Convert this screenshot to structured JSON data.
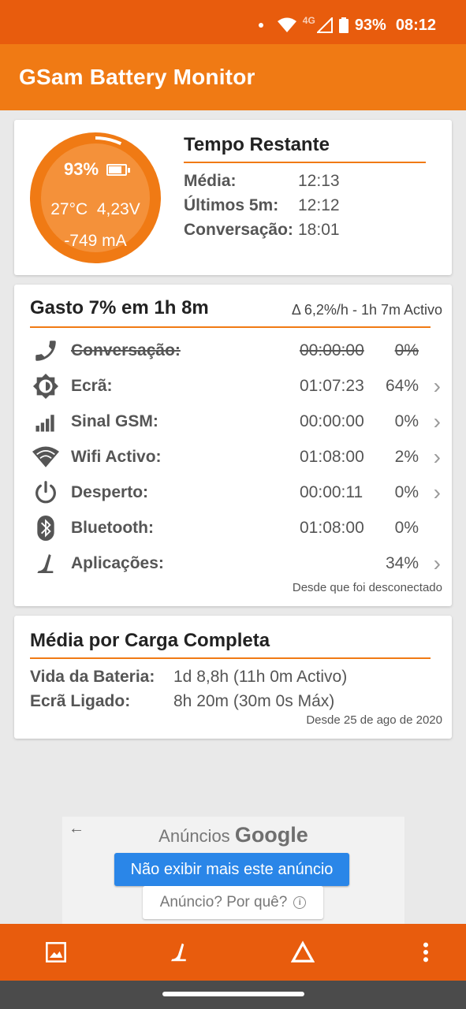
{
  "status_bar": {
    "network": "4G",
    "battery": "93%",
    "time": "08:12"
  },
  "app": {
    "title": "GSam Battery Monitor"
  },
  "colors": {
    "accent": "#f07a14",
    "dark_accent": "#e85c0d",
    "ad_button": "#2a86e8"
  },
  "gauge": {
    "percent_label": "93%",
    "temperature": "27°C",
    "voltage": "4,23V",
    "current": "-749 mA",
    "level": 0.93
  },
  "time_remaining": {
    "title": "Tempo Restante",
    "rows": [
      {
        "label": "Média:",
        "value": "12:13"
      },
      {
        "label": "Últimos 5m:",
        "value": "12:12"
      },
      {
        "label": "Conversação:",
        "value": "18:01"
      }
    ]
  },
  "usage": {
    "title": "Gasto 7% em 1h 8m",
    "rate": "Δ 6,2%/h - 1h 7m Activo",
    "rows": [
      {
        "icon": "phone-icon",
        "label": "Conversação:",
        "time": "00:00:00",
        "pct": "0%",
        "struck": true,
        "chevron": false
      },
      {
        "icon": "brightness-icon",
        "label": "Ecrã:",
        "time": "01:07:23",
        "pct": "64%",
        "struck": false,
        "chevron": true
      },
      {
        "icon": "signal-icon",
        "label": "Sinal GSM:",
        "time": "00:00:00",
        "pct": "0%",
        "struck": false,
        "chevron": true
      },
      {
        "icon": "wifi-icon",
        "label": "Wifi Activo:",
        "time": "01:08:00",
        "pct": "2%",
        "struck": false,
        "chevron": true
      },
      {
        "icon": "power-icon",
        "label": "Desperto:",
        "time": "00:00:11",
        "pct": "0%",
        "struck": false,
        "chevron": true
      },
      {
        "icon": "bluetooth-icon",
        "label": "Bluetooth:",
        "time": "01:08:00",
        "pct": "0%",
        "struck": false,
        "chevron": false
      },
      {
        "icon": "apps-icon",
        "label": "Aplicações:",
        "time": "",
        "pct": "34%",
        "struck": false,
        "chevron": true
      }
    ],
    "footer": "Desde que foi desconectado"
  },
  "average": {
    "title": "Média por Carga Completa",
    "rows": [
      {
        "label": "Vida da Bateria:",
        "value": "1d 8,8h (11h 0m Activo)"
      },
      {
        "label": "Ecrã Ligado:",
        "value": "8h 20m (30m 0s Máx)"
      }
    ],
    "footer": "Desde 25 de ago de 2020"
  },
  "ad": {
    "title_prefix": "Anúncios",
    "title_brand": "Google",
    "stop_button": "Não exibir mais este anúncio",
    "why_button": "Anúncio? Por quê?"
  },
  "bottom_bar": [
    "image-icon",
    "apps-icon",
    "delta-icon",
    "more-icon"
  ]
}
